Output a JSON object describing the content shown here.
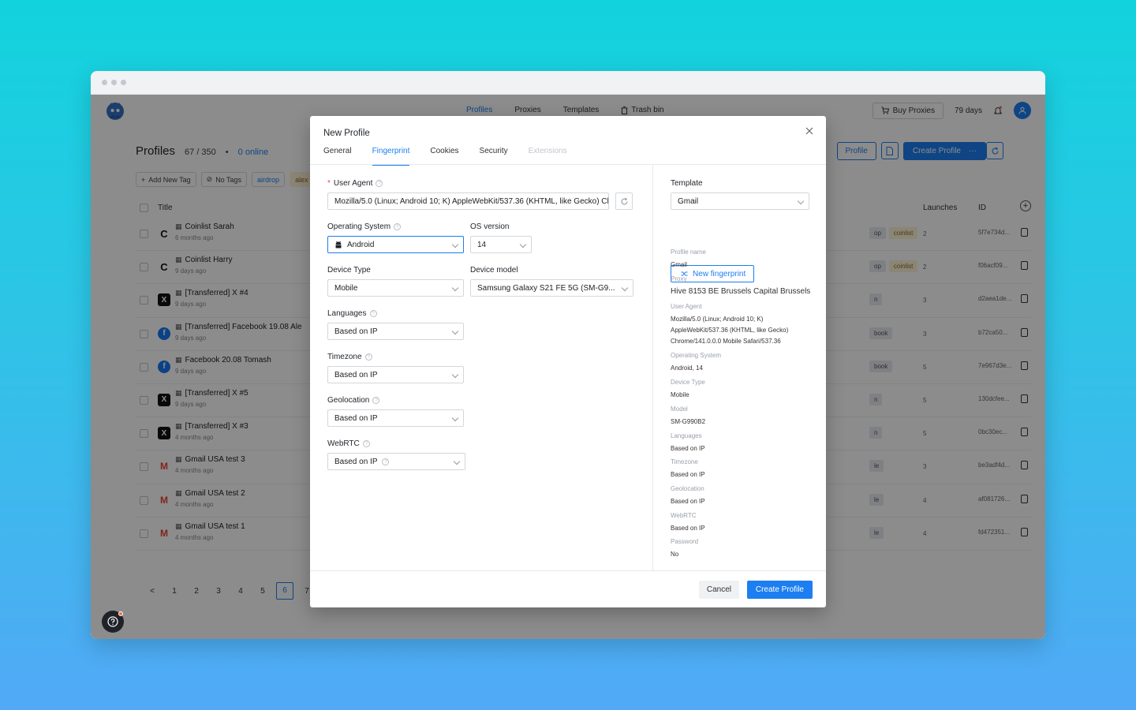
{
  "topbar": {
    "nav": [
      "Profiles",
      "Proxies",
      "Templates",
      "Trash bin"
    ],
    "buy_proxies": "Buy Proxies",
    "days": "79 days"
  },
  "page": {
    "title": "Profiles",
    "count": "67 / 350",
    "online": "0 online",
    "profile_btn": "Profile",
    "create_btn": "Create Profile",
    "create_more": "···"
  },
  "tagbar": {
    "add_tag": "Add New Tag",
    "no_tags": "No Tags",
    "tags": [
      "airdrop",
      "alex"
    ]
  },
  "table": {
    "headers": {
      "title": "Title",
      "launches": "Launches",
      "id": "ID"
    },
    "rows": [
      {
        "icon": "C",
        "name": "Coinlist Sarah",
        "time": "6 months ago",
        "tags": [
          "op",
          "coinlist"
        ],
        "launches": "2",
        "id": "5f7e734d..."
      },
      {
        "icon": "C",
        "name": "Coinlist Harry",
        "time": "9 days ago",
        "tags": [
          "op",
          "coinlist"
        ],
        "launches": "2",
        "id": "f06acf09..."
      },
      {
        "icon": "X",
        "name": "[Transferred] X #4",
        "time": "9 days ago",
        "tags": [
          "n"
        ],
        "launches": "3",
        "id": "d2aea1de..."
      },
      {
        "icon": "f",
        "name": "[Transferred] Facebook 19.08 Ale",
        "time": "9 days ago",
        "tags": [
          "book"
        ],
        "launches": "3",
        "id": "b72ca50..."
      },
      {
        "icon": "f",
        "name": "Facebook 20.08 Tomash",
        "time": "9 days ago",
        "tags": [
          "book"
        ],
        "launches": "5",
        "id": "7e967d3e..."
      },
      {
        "icon": "X",
        "name": "[Transferred] X #5",
        "time": "9 days ago",
        "tags": [
          "n"
        ],
        "launches": "5",
        "id": "130dcfee..."
      },
      {
        "icon": "X",
        "name": "[Transferred] X #3",
        "time": "4 months ago",
        "tags": [
          "n"
        ],
        "launches": "5",
        "id": "0bc30ec..."
      },
      {
        "icon": "M",
        "name": "Gmail USA test 3",
        "time": "4 months ago",
        "tags": [
          "le"
        ],
        "launches": "3",
        "id": "be3adf4d..."
      },
      {
        "icon": "M",
        "name": "Gmail USA test 2",
        "time": "4 months ago",
        "tags": [
          "le"
        ],
        "launches": "4",
        "id": "af081726..."
      },
      {
        "icon": "M",
        "name": "Gmail USA test 1",
        "time": "4 months ago",
        "tags": [
          "le"
        ],
        "launches": "4",
        "id": "fd472351..."
      }
    ]
  },
  "pager": {
    "prev": "<",
    "pages": [
      "1",
      "2",
      "3",
      "4",
      "5",
      "6",
      "7"
    ],
    "current": "6"
  },
  "modal": {
    "title": "New Profile",
    "tabs": [
      "General",
      "Fingerprint",
      "Cookies",
      "Security",
      "Extensions"
    ],
    "active_tab": "Fingerprint",
    "user_agent": {
      "label": "User Agent",
      "value": "Mozilla/5.0 (Linux; Android 10; K) AppleWebKit/537.36 (KHTML, like Gecko) Chrome/141.0.0.0 Mobile Safari/537.36"
    },
    "os": {
      "label": "Operating System",
      "value": "Android"
    },
    "os_version": {
      "label": "OS version",
      "value": "14"
    },
    "device_type": {
      "label": "Device Type",
      "value": "Mobile"
    },
    "device_model": {
      "label": "Device model",
      "value": "Samsung Galaxy S21 FE 5G (SM-G9..."
    },
    "languages": {
      "label": "Languages",
      "value": "Based on IP"
    },
    "timezone": {
      "label": "Timezone",
      "value": "Based on IP"
    },
    "geolocation": {
      "label": "Geolocation",
      "value": "Based on IP"
    },
    "webrtc": {
      "label": "WebRTC",
      "value": "Based on IP"
    },
    "template": {
      "label": "Template",
      "value": "Gmail"
    },
    "new_fingerprint": "New fingerprint",
    "summary": [
      {
        "k": "Profile name",
        "v": "Gmail"
      },
      {
        "k": "Proxy",
        "v": "Hive 8153 BE Brussels Capital Brussels"
      },
      {
        "k": "User Agent",
        "v": "Mozilla/5.0 (Linux; Android 10; K) AppleWebKit/537.36 (KHTML, like Gecko) Chrome/141.0.0.0 Mobile Safari/537.36"
      },
      {
        "k": "Operating System",
        "v": "Android, 14"
      },
      {
        "k": "Device Type",
        "v": "Mobile"
      },
      {
        "k": "Model",
        "v": "SM-G990B2"
      },
      {
        "k": "Languages",
        "v": "Based on IP"
      },
      {
        "k": "Timezone",
        "v": "Based on IP"
      },
      {
        "k": "Geolocation",
        "v": "Based on IP"
      },
      {
        "k": "WebRTC",
        "v": "Based on IP"
      },
      {
        "k": "Password",
        "v": "No"
      }
    ],
    "cancel": "Cancel",
    "create": "Create Profile"
  },
  "colors": {
    "accent": "#1c7ef0",
    "overlay": "rgba(0,0,0,0.45)",
    "chip": "#fdf3d8"
  },
  "icons": [
    "logo-icon",
    "trash-icon",
    "cart-icon",
    "bell-icon",
    "user-icon",
    "plus-icon",
    "tag-icon",
    "grid-icon",
    "copy-icon",
    "help-icon",
    "close-icon",
    "refresh-icon",
    "android-icon",
    "shuffle-icon",
    "chevron-down-icon"
  ]
}
